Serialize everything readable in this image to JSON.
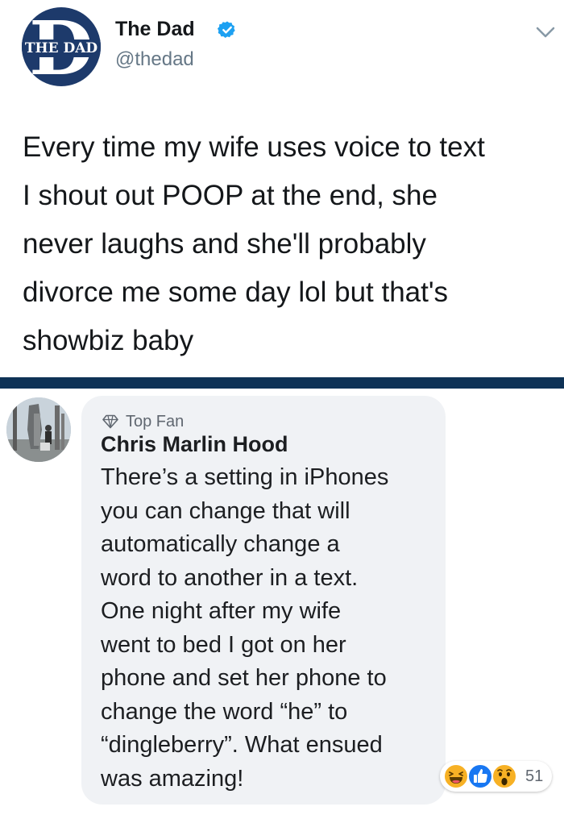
{
  "tweet": {
    "avatar_text": "THE DAD",
    "avatar_letter": "D",
    "display_name": "The Dad",
    "handle": "@thedad",
    "lines": [
      "Every time my wife uses voice to text",
      "I shout out POOP at the end, she",
      "never laughs and she'll probably",
      "divorce me some day lol but that's",
      "showbiz baby"
    ]
  },
  "comment": {
    "badge": "Top Fan",
    "author": "Chris Marlin Hood",
    "lines": [
      "There’s a setting in iPhones",
      "you can change that will",
      "automatically change a",
      "word to another in a text.",
      "One night after my wife",
      "went to bed I got on her",
      "phone and set her phone to",
      "change the word “he” to",
      "“dingleberry”. What ensued",
      "was amazing!"
    ],
    "reactions": [
      "haha-icon",
      "like-icon",
      "wow-icon"
    ],
    "reaction_count": "51"
  },
  "colors": {
    "twitter_blue": "#1da1f2",
    "divider": "#0e3256",
    "bubble": "#f0f2f5",
    "fb_blue": "#1877f2",
    "reaction_yellow": "#f7b125"
  }
}
